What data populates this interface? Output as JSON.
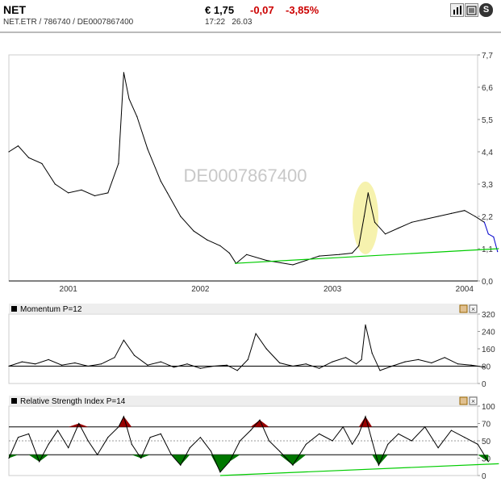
{
  "header": {
    "symbol": "NET",
    "exchange_line": "NET.ETR  /  786740  /  DE0007867400",
    "price": "€ 1,75",
    "change": "-0,07",
    "change_pct": "-3,85%",
    "time": "17:22",
    "date": "26.03",
    "icons": [
      "bar-chart-icon",
      "news-icon",
      "s-icon"
    ]
  },
  "chart_data": [
    {
      "type": "line",
      "watermark": "DE0007867400",
      "x_tick_labels": [
        "2001",
        "2002",
        "2003",
        "2004"
      ],
      "y_tick_labels": [
        "7,7",
        "6,6",
        "5,5",
        "4,4",
        "3,3",
        "2,2",
        "1,1",
        "0,0"
      ],
      "ylim": [
        0,
        7.7
      ],
      "series": [
        {
          "color": "#000000",
          "x": [
            2000.55,
            2000.62,
            2000.7,
            2000.8,
            2000.9,
            2001.0,
            2001.1,
            2001.2,
            2001.3,
            2001.38,
            2001.42,
            2001.46,
            2001.52,
            2001.6,
            2001.7,
            2001.75,
            2001.85,
            2001.95,
            2002.05,
            2002.15,
            2002.22,
            2002.27,
            2002.35,
            2002.5,
            2002.7,
            2002.9,
            2003.05,
            2003.15,
            2003.2,
            2003.24,
            2003.27,
            2003.32,
            2003.4,
            2003.5,
            2003.6,
            2003.7,
            2003.8,
            2003.9,
            2004.0,
            2004.08,
            2004.15
          ],
          "values": [
            4.4,
            4.6,
            4.2,
            4.0,
            3.3,
            3.0,
            3.1,
            2.9,
            3.0,
            4.0,
            7.1,
            6.2,
            5.6,
            4.5,
            3.4,
            3.0,
            2.2,
            1.7,
            1.4,
            1.2,
            0.95,
            0.6,
            0.9,
            0.7,
            0.55,
            0.85,
            0.9,
            0.95,
            1.2,
            2.2,
            3.0,
            2.0,
            1.6,
            1.8,
            2.0,
            2.1,
            2.2,
            2.3,
            2.4,
            2.2,
            2.0
          ]
        },
        {
          "color": "#0000cc",
          "x": [
            2004.15,
            2004.18,
            2004.22,
            2004.25
          ],
          "values": [
            2.0,
            1.6,
            1.5,
            1.0
          ]
        }
      ],
      "trendline": {
        "color": "#00cc00",
        "x": [
          2002.26,
          2004.26
        ],
        "values": [
          0.6,
          1.1
        ]
      },
      "highlight": {
        "x": 2003.25,
        "y": 2.15,
        "color": "#f5f0a0"
      }
    },
    {
      "type": "line",
      "title": "Momentum P=12",
      "y_tick_labels": [
        "320",
        "240",
        "160",
        "80",
        "0"
      ],
      "ylim": [
        0,
        320
      ],
      "reference_line": 80,
      "series": [
        {
          "color": "#000000",
          "x": [
            2000.55,
            2000.65,
            2000.75,
            2000.85,
            2000.95,
            2001.05,
            2001.15,
            2001.25,
            2001.35,
            2001.42,
            2001.5,
            2001.6,
            2001.7,
            2001.8,
            2001.9,
            2002.0,
            2002.1,
            2002.2,
            2002.28,
            2002.36,
            2002.42,
            2002.5,
            2002.6,
            2002.7,
            2002.8,
            2002.9,
            2003.0,
            2003.1,
            2003.18,
            2003.22,
            2003.25,
            2003.3,
            2003.36,
            2003.45,
            2003.55,
            2003.65,
            2003.75,
            2003.85,
            2003.95,
            2004.05,
            2004.15
          ],
          "values": [
            80,
            100,
            90,
            110,
            85,
            95,
            80,
            90,
            120,
            200,
            130,
            85,
            100,
            75,
            90,
            70,
            80,
            85,
            60,
            110,
            230,
            160,
            95,
            80,
            90,
            70,
            100,
            120,
            90,
            110,
            270,
            140,
            60,
            80,
            100,
            110,
            95,
            120,
            90,
            85,
            75
          ]
        }
      ]
    },
    {
      "type": "line",
      "title": "Relative Strength Index P=14",
      "y_tick_labels": [
        "100",
        "70",
        "50",
        "30",
        "0"
      ],
      "ylim": [
        0,
        100
      ],
      "reference_lines": [
        70,
        50,
        30
      ],
      "overbought_color": "#990000",
      "oversold_color": "#007700",
      "series": [
        {
          "color": "#000000",
          "x": [
            2000.55,
            2000.62,
            2000.7,
            2000.78,
            2000.85,
            2000.92,
            2001.0,
            2001.08,
            2001.15,
            2001.22,
            2001.3,
            2001.38,
            2001.42,
            2001.48,
            2001.55,
            2001.62,
            2001.7,
            2001.78,
            2001.85,
            2001.92,
            2002.0,
            2002.08,
            2002.15,
            2002.22,
            2002.3,
            2002.38,
            2002.45,
            2002.52,
            2002.6,
            2002.7,
            2002.8,
            2002.9,
            2003.0,
            2003.08,
            2003.15,
            2003.2,
            2003.25,
            2003.3,
            2003.35,
            2003.42,
            2003.5,
            2003.6,
            2003.7,
            2003.8,
            2003.9,
            2004.0,
            2004.1,
            2004.18
          ],
          "values": [
            25,
            55,
            60,
            20,
            45,
            65,
            40,
            75,
            50,
            30,
            55,
            70,
            85,
            45,
            25,
            55,
            60,
            30,
            15,
            40,
            55,
            35,
            5,
            20,
            50,
            65,
            80,
            50,
            35,
            15,
            45,
            60,
            50,
            70,
            45,
            60,
            85,
            50,
            15,
            45,
            60,
            50,
            70,
            40,
            65,
            55,
            45,
            20
          ]
        }
      ],
      "trendline": {
        "color": "#00cc00",
        "x": [
          2002.15,
          2004.26
        ],
        "values": [
          0,
          17
        ]
      }
    }
  ],
  "panels": {
    "momentum": {
      "label": "Momentum P=12"
    },
    "rsi": {
      "label": "Relative Strength Index P=14"
    }
  }
}
